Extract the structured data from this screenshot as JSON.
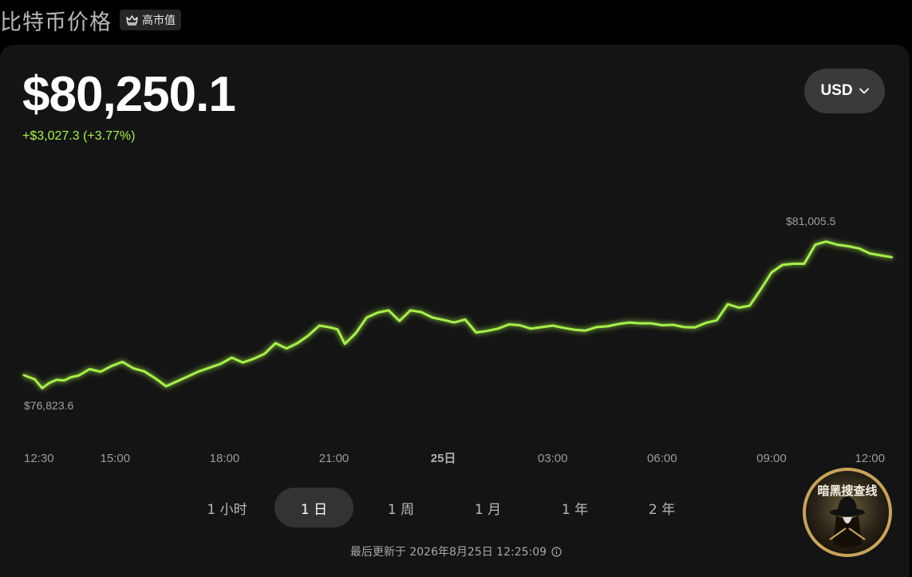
{
  "header": {
    "title": "比特币价格",
    "badge": "高市值"
  },
  "price": {
    "value": "$80,250.1",
    "change": "+$3,027.3 (+3.77%)"
  },
  "currency": {
    "label": "USD"
  },
  "ranges": [
    {
      "label": "1 小时",
      "active": false
    },
    {
      "label": "1 日",
      "active": true
    },
    {
      "label": "1 周",
      "active": false
    },
    {
      "label": "1 月",
      "active": false
    },
    {
      "label": "1 年",
      "active": false
    },
    {
      "label": "2 年",
      "active": false
    }
  ],
  "updated": "最后更新于 2026年8月25日 12:25:09",
  "watermark": {
    "text": "暗黑搜查线"
  },
  "colors": {
    "line": "#a6f04a",
    "change": "#a6f04a",
    "card": "#141414"
  },
  "chart_data": {
    "type": "line",
    "x_ticks": [
      "12:30",
      "15:00",
      "18:00",
      "21:00",
      "25日",
      "03:00",
      "06:00",
      "09:00",
      "12:00"
    ],
    "x_tick_hours": [
      12.5,
      15,
      18,
      21,
      24,
      27,
      30,
      33,
      36
    ],
    "bold_tick": "25日",
    "min_label": "$76,823.6",
    "max_label": "$81,005.5",
    "ylim": [
      76823.6,
      81005.5
    ],
    "series": [
      {
        "x": [
          12.5,
          12.8,
          13.0,
          13.2,
          13.4,
          13.6,
          13.8,
          14.0,
          14.3,
          14.6,
          14.9,
          15.2,
          15.5,
          15.8,
          16.1,
          16.4,
          16.7,
          17.0,
          17.3,
          17.6,
          17.9,
          18.2,
          18.5,
          18.8,
          19.1,
          19.4,
          19.7,
          20.0,
          20.3,
          20.6,
          20.9,
          21.1,
          21.3,
          21.6,
          21.9,
          22.2,
          22.5,
          22.8,
          23.1,
          23.4,
          23.7,
          24.0,
          24.3,
          24.6,
          24.9,
          25.2,
          25.5,
          25.8,
          26.1,
          26.4,
          26.7,
          27.0,
          27.3,
          27.6,
          27.9,
          28.2,
          28.5,
          28.8,
          29.1,
          29.4,
          29.7,
          30.0,
          30.3,
          30.6,
          30.9,
          31.2,
          31.5,
          31.8,
          32.1,
          32.4,
          32.7,
          33.0,
          33.3,
          33.6,
          33.9,
          34.2,
          34.5,
          34.8,
          35.1,
          35.4,
          35.7,
          36.0,
          36.3
        ],
        "y": [
          77260,
          77150,
          76920,
          77060,
          77140,
          77120,
          77210,
          77250,
          77420,
          77350,
          77500,
          77610,
          77440,
          77360,
          77180,
          76970,
          77100,
          77230,
          77360,
          77460,
          77560,
          77720,
          77590,
          77690,
          77820,
          78100,
          77960,
          78100,
          78300,
          78560,
          78510,
          78460,
          78080,
          78360,
          78770,
          78900,
          78960,
          78680,
          78960,
          78910,
          78770,
          78710,
          78640,
          78720,
          78380,
          78420,
          78480,
          78590,
          78570,
          78480,
          78520,
          78560,
          78500,
          78450,
          78430,
          78520,
          78540,
          78600,
          78640,
          78620,
          78620,
          78570,
          78580,
          78520,
          78510,
          78630,
          78700,
          79120,
          79030,
          79080,
          79500,
          79950,
          80150,
          80180,
          80180,
          80680,
          80760,
          80680,
          80640,
          80580,
          80450,
          80400,
          80350
        ],
        "name": ""
      }
    ]
  }
}
